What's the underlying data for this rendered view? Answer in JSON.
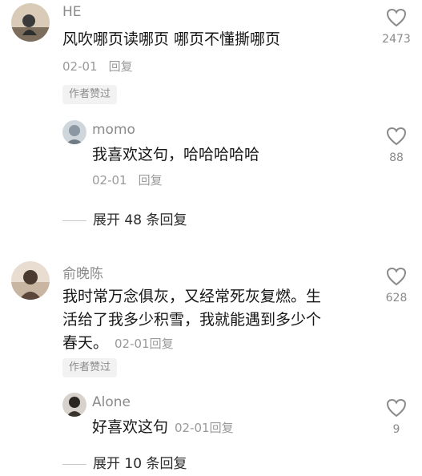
{
  "comments": [
    {
      "user": "HE",
      "text_lines": [
        "风吹哪页读哪页 哪页不懂撕哪页"
      ],
      "date": "02-01",
      "reply_label": "回复",
      "badge": "作者赞过",
      "likes": "2473",
      "reply": {
        "user": "momo",
        "text": "我喜欢这句，哈哈哈哈哈",
        "date": "02-01",
        "reply_label": "回复",
        "likes": "88"
      },
      "expand_label": "展开 48 条回复"
    },
    {
      "user": "俞晚陈",
      "text_lines": [
        "我时常万念俱灰，又经常死灰复燃。生",
        "活给了我多少积雪，我就能遇到多少个",
        "春天。"
      ],
      "date": "02-01",
      "reply_label": "回复",
      "badge": "作者赞过",
      "likes": "628",
      "reply": {
        "user": "Alone",
        "text": "好喜欢这句",
        "date": "02-01",
        "reply_label": "回复",
        "likes": "9"
      },
      "expand_label": "展开 10 条回复"
    }
  ]
}
